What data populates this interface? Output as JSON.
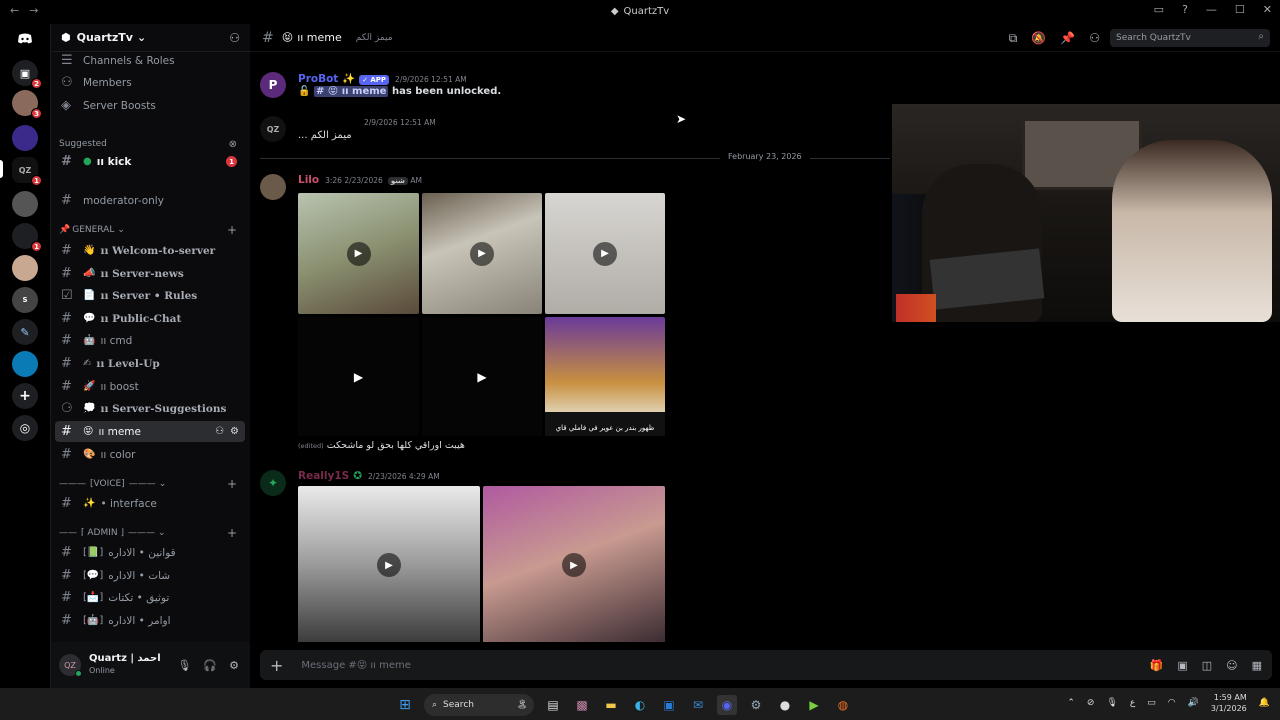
{
  "window": {
    "title": "QuartzTv"
  },
  "guild": {
    "name": "QuartzTv"
  },
  "sidebar": {
    "top_items": [
      "Channels & Roles",
      "Members",
      "Server Boosts"
    ],
    "suggested": {
      "label": "Suggested",
      "channel": "ıı kick",
      "badge": "1"
    },
    "moderator_only": "moderator-only",
    "general_category": "GENERAL",
    "general": [
      {
        "emoji": "👋",
        "label": "ıı Welcom-to-server"
      },
      {
        "emoji": "📣",
        "label": "ıı Server-news"
      },
      {
        "emoji": "📄",
        "label": "ıı Server • Rules"
      },
      {
        "emoji": "💬",
        "label": "ıı Public-Chat"
      },
      {
        "emoji": "🤖",
        "label": "ıı cmd"
      },
      {
        "emoji": "✍",
        "label": "ıı Level-Up"
      },
      {
        "emoji": "🚀",
        "label": "ıı boost"
      },
      {
        "emoji": "💭",
        "label": "ıı Server-Suggestions"
      },
      {
        "emoji": "😝",
        "label": "ıı meme"
      },
      {
        "emoji": "🎨",
        "label": "ıı color"
      }
    ],
    "voice_category": "[VOICE]",
    "voice": [
      {
        "emoji": "✨",
        "label": "• interface"
      }
    ],
    "admin_category": "⌈ ADMIN ⌋",
    "admin": [
      {
        "label": "قوانين • الاداره"
      },
      {
        "label": "شات • الاداره"
      },
      {
        "label": "توثيق • تكتات"
      },
      {
        "label": "اوامر • الاداره"
      }
    ]
  },
  "user": {
    "name": "Quartz | احمد",
    "status": "Online"
  },
  "channel": {
    "name": "ıı meme",
    "topic": "ميمز الكم"
  },
  "search": {
    "placeholder": "Search QuartzTv"
  },
  "messages": {
    "probot": {
      "author": "ProBot ✨",
      "badge": "✓ APP",
      "time": "2/9/2026 12:51 AM",
      "text_channel": "ıı meme",
      "text_suffix": "has been unlocked."
    },
    "reply": {
      "time": "2/9/2026 12:51 AM",
      "text": "... ميمز الكم"
    },
    "date_divider": "February 23, 2026",
    "lilo": {
      "author": "Lilo",
      "tag": "شنو",
      "time": "2/23/2026 3:26 AM",
      "caption": "هيبت اوراقي كلها بحق لو ماشحكت",
      "edited": "(edited)",
      "media_caption": "ظهور بندر بن عوير في فاملي قاي"
    },
    "reily": {
      "author": "Really1S",
      "time": "2/23/2026 4:29 AM"
    }
  },
  "composer": {
    "placeholder": "Message #😝 ıı meme"
  },
  "taskbar": {
    "search": "Search",
    "time": "1:59 AM",
    "date": "3/1/2026",
    "lang": "ع"
  }
}
